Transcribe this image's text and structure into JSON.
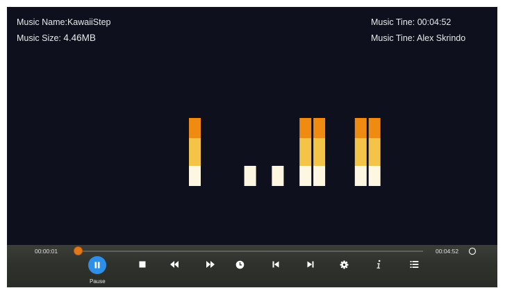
{
  "info": {
    "name_label": "Music Name:",
    "name_value": "KawaiiStep",
    "size_label": "Music Size:",
    "size_value": "4.46MB",
    "time_label": "Music Tine:",
    "time_value": "00:04:52",
    "artist_label": "Music Tine:",
    "artist_value": "Alex Skrindo"
  },
  "playback": {
    "current_time": "00:00:01",
    "total_time": "00:04:52",
    "progress_fraction": 0.0
  },
  "controls": [
    {
      "name": "pause",
      "label": "Pause",
      "icon": "pause-icon",
      "active": true
    },
    {
      "name": "stop",
      "icon": "stop-icon"
    },
    {
      "name": "rewind",
      "icon": "rewind-icon"
    },
    {
      "name": "fast-forward",
      "icon": "fast-forward-icon"
    },
    {
      "name": "sleep-timer",
      "icon": "clock-icon"
    },
    {
      "name": "previous",
      "icon": "skip-previous-icon"
    },
    {
      "name": "next",
      "icon": "skip-next-icon"
    },
    {
      "name": "settings",
      "icon": "gear-icon"
    },
    {
      "name": "info",
      "icon": "info-icon"
    },
    {
      "name": "playlist",
      "icon": "playlist-icon"
    }
  ],
  "spectrum": {
    "band_levels": [
      3,
      0,
      0,
      0,
      1,
      0,
      1,
      0,
      3,
      3,
      0,
      0,
      3,
      3
    ],
    "colors": {
      "low": "#fdf7e2",
      "mid": "#f4c448",
      "high": "#ee8b10"
    }
  },
  "colors": {
    "background": "#0e111d",
    "accent": "#2d8fe8",
    "progress_knob": "#e3781b",
    "text": "#e8e8ea"
  }
}
